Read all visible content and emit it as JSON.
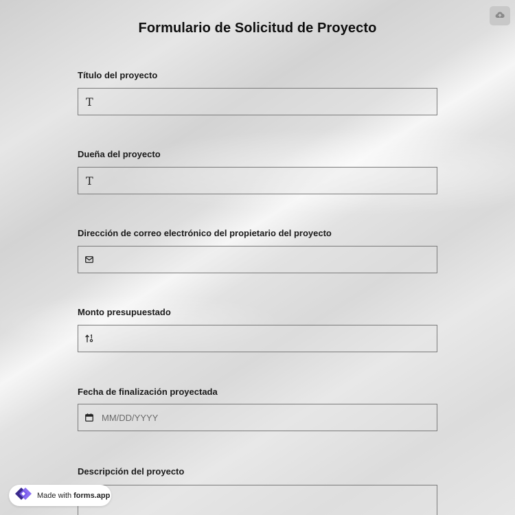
{
  "form": {
    "title": "Formulario de Solicitud de Proyecto"
  },
  "header": {
    "upload_icon": "cloud-upload-icon"
  },
  "fields": [
    {
      "label": "Título del proyecto",
      "icon": "text-icon",
      "icon_glyph": "T",
      "value": "",
      "placeholder": ""
    },
    {
      "label": "Dueña del proyecto",
      "icon": "text-icon",
      "icon_glyph": "T",
      "value": "",
      "placeholder": ""
    },
    {
      "label": "Dirección de correo electrónico del propietario del proyecto",
      "icon": "envelope-icon",
      "value": "",
      "placeholder": ""
    },
    {
      "label": "Monto presupuestado",
      "icon": "number-sort-icon",
      "value": "",
      "placeholder": ""
    },
    {
      "label": "Fecha de finalización proyectada",
      "icon": "calendar-icon",
      "value": "",
      "placeholder": "MM/DD/YYYY"
    },
    {
      "label": "Descripción del proyecto",
      "icon": "",
      "value": "",
      "placeholder": ""
    }
  ],
  "badge": {
    "prefix": "Made with",
    "brand": "forms.app",
    "logo_icon": "forms-app-logo-icon"
  },
  "colors": {
    "logo_purple": "#7b5cf0",
    "logo_dark": "#3a2a8c",
    "border": "#7a7a7a"
  }
}
